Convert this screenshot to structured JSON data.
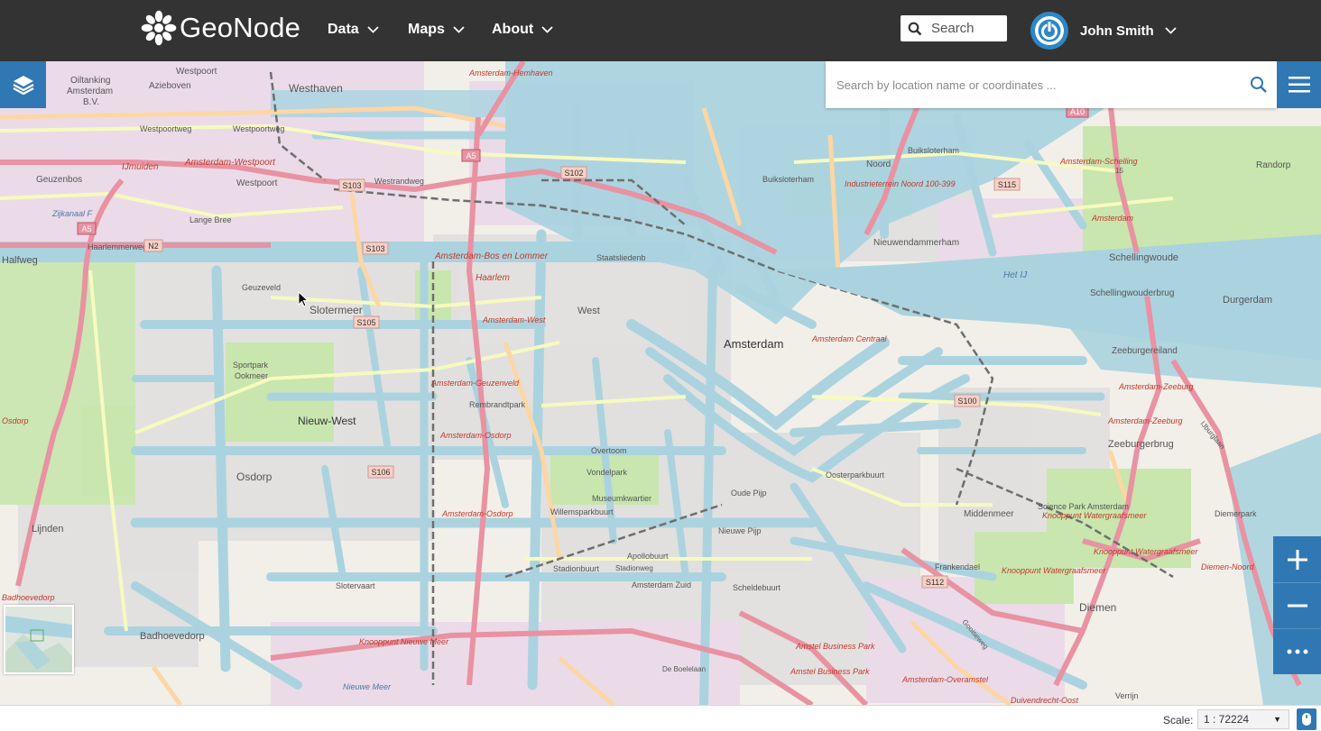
{
  "navbar": {
    "brand": "GeoNode",
    "menu": [
      {
        "label": "Data"
      },
      {
        "label": "Maps"
      },
      {
        "label": "About"
      }
    ],
    "search_placeholder": "Search",
    "user_name": "John Smith"
  },
  "map": {
    "location_search_placeholder": "Search by location name or coordinates ...",
    "labels": {
      "westhaven": "Westhaven",
      "westpoort": "Westpoort",
      "azieboven": "Azieboven",
      "oiltanking": "Oiltanking",
      "oiltanking2": "Amsterdam",
      "oiltanking3": "B.V.",
      "westpoortweg": "Westpoortweg",
      "westpoortweg2": "Westpoortweg",
      "ijmuiden": "IJmuiden",
      "am_westpoort": "Amsterdam-Westpoort",
      "westpoort2": "Westpoort",
      "westrandweg": "Westrandweg",
      "s103a": "S103",
      "s103b": "S103",
      "a5a": "A5",
      "a5b": "A5",
      "s102": "S102",
      "geuzenbos": "Geuzenbos",
      "zijkanaal": "Zijkanaal F",
      "lange_bree": "Lange Bree",
      "haarlemmerweg": "Haarlemmerweg",
      "n2": "N2",
      "halfweg": "Halfweg",
      "am_bos": "Amsterdam-Bos en Lommer",
      "haarlem": "Haarlem",
      "staatslieden": "Staatsliedenb",
      "geuzeveld": "Geuzeveld",
      "slotermeer": "Slotermeer",
      "s105": "S105",
      "west": "West",
      "am_hemhaven": "Amsterdam-Hemhaven",
      "am_west": "Amsterdam-West",
      "buiksloterham": "Buiksloterham",
      "buiksloterham2": "Buiksloterham",
      "noord": "Noord",
      "industrie": "Industrieterrein Noord 100-399",
      "s115": "S115",
      "am_schelling": "Amsterdam-Schelling",
      "randorp": "Randorp",
      "a10": "A10",
      "nieuwendammerham": "Nieuwendammerham",
      "schellingwoude": "Schellingwoude",
      "am_noord": "Amsterdam",
      "het_ij": "Het IJ",
      "schellingwouderbrug": "Schellingwouderbrug",
      "durgerdam": "Durgerdam",
      "centraal": "Amsterdam Centraal",
      "amsterdam": "Amsterdam",
      "zeeburgereiland": "Zeeburgereiland",
      "am_zeeburg": "Amsterdam-Zeeburg",
      "am_zeeburg2": "Amsterdam-Zeeburg",
      "zeeburgerbrug": "Zeeburgerbrug",
      "s100": "S100",
      "sportpark": "Sportpark",
      "ookmeer": "Ookmeer",
      "nieuw_west": "Nieuw-West",
      "am_geuzenveld": "Amsterdam-Geuzenveld",
      "rembrandtpark": "Rembrandtpark",
      "am_osdorp": "Amsterdam-Osdorp",
      "osdorp_left": "Osdorp",
      "overtoom": "Overtoom",
      "vondelpark": "Vondelpark",
      "oosterparkbuurt": "Oosterparkbuurt",
      "osdorp": "Osdorp",
      "s106": "S106",
      "museumkwartier": "Museumkwartier",
      "willemspark": "Willemsparkbuurt",
      "am_zuid": "Amsterdam-Osdorp",
      "de_pijp": "Oude Pijp",
      "middenmeer": "Middenmeer",
      "science_park": "Science Park Amsterdam",
      "knooppunt_w1": "Knooppunt Watergraafsmeer",
      "knooppunt_w2": "Knooppunt Watergraafsmeer",
      "knooppunt_w3": "Knooppunt Watergraafsmeer",
      "diemerpark": "Diemerpark",
      "diemen_noord": "Diemen-Noord",
      "lijnden": "Lijnden",
      "apollobuurt": "Apollobuurt",
      "stadionbuurt": "Stadionbuurt",
      "stadionweg": "Stadionweg",
      "nieuwe_pijp": "Nieuwe Pijp",
      "frankendael": "Frankendael",
      "s112": "S112",
      "scheldebuurt": "Scheldebuurt",
      "diemen": "Diemen",
      "badhoevedorp": "Badhoevedorp",
      "badhoevedorp_l": "Badhoevedorp",
      "slotervaart": "Slotervaart",
      "knooppunt_nm": "Knooppunt Nieuwe Meer",
      "buitenveldert": "Amstel Business Park",
      "buitenveldert2": "Amstel Business Park",
      "am_overamstel": "Amsterdam-Overamstel",
      "de_boelelaan": "De Boelelaan",
      "duivendrecht": "Duivendrecht-Oost",
      "verrijn": "Verrijn",
      "nieuwe_meer": "Nieuwe Meer",
      "amsterdam_z": "Amsterdam Zuid",
      "fifteen": "15",
      "gooiseweg": "Gooiseweg",
      "ijburglaan": "IJburglaan"
    }
  },
  "footer": {
    "scale_label": "Scale:",
    "scale_value": "1 : 72224"
  },
  "colors": {
    "navbar_bg": "#333333",
    "accent_blue": "#2f78b4",
    "water": "#aad3df",
    "motorway": "#e892a2",
    "primary_road": "#fcd6a4",
    "park": "#c8e6ad"
  }
}
